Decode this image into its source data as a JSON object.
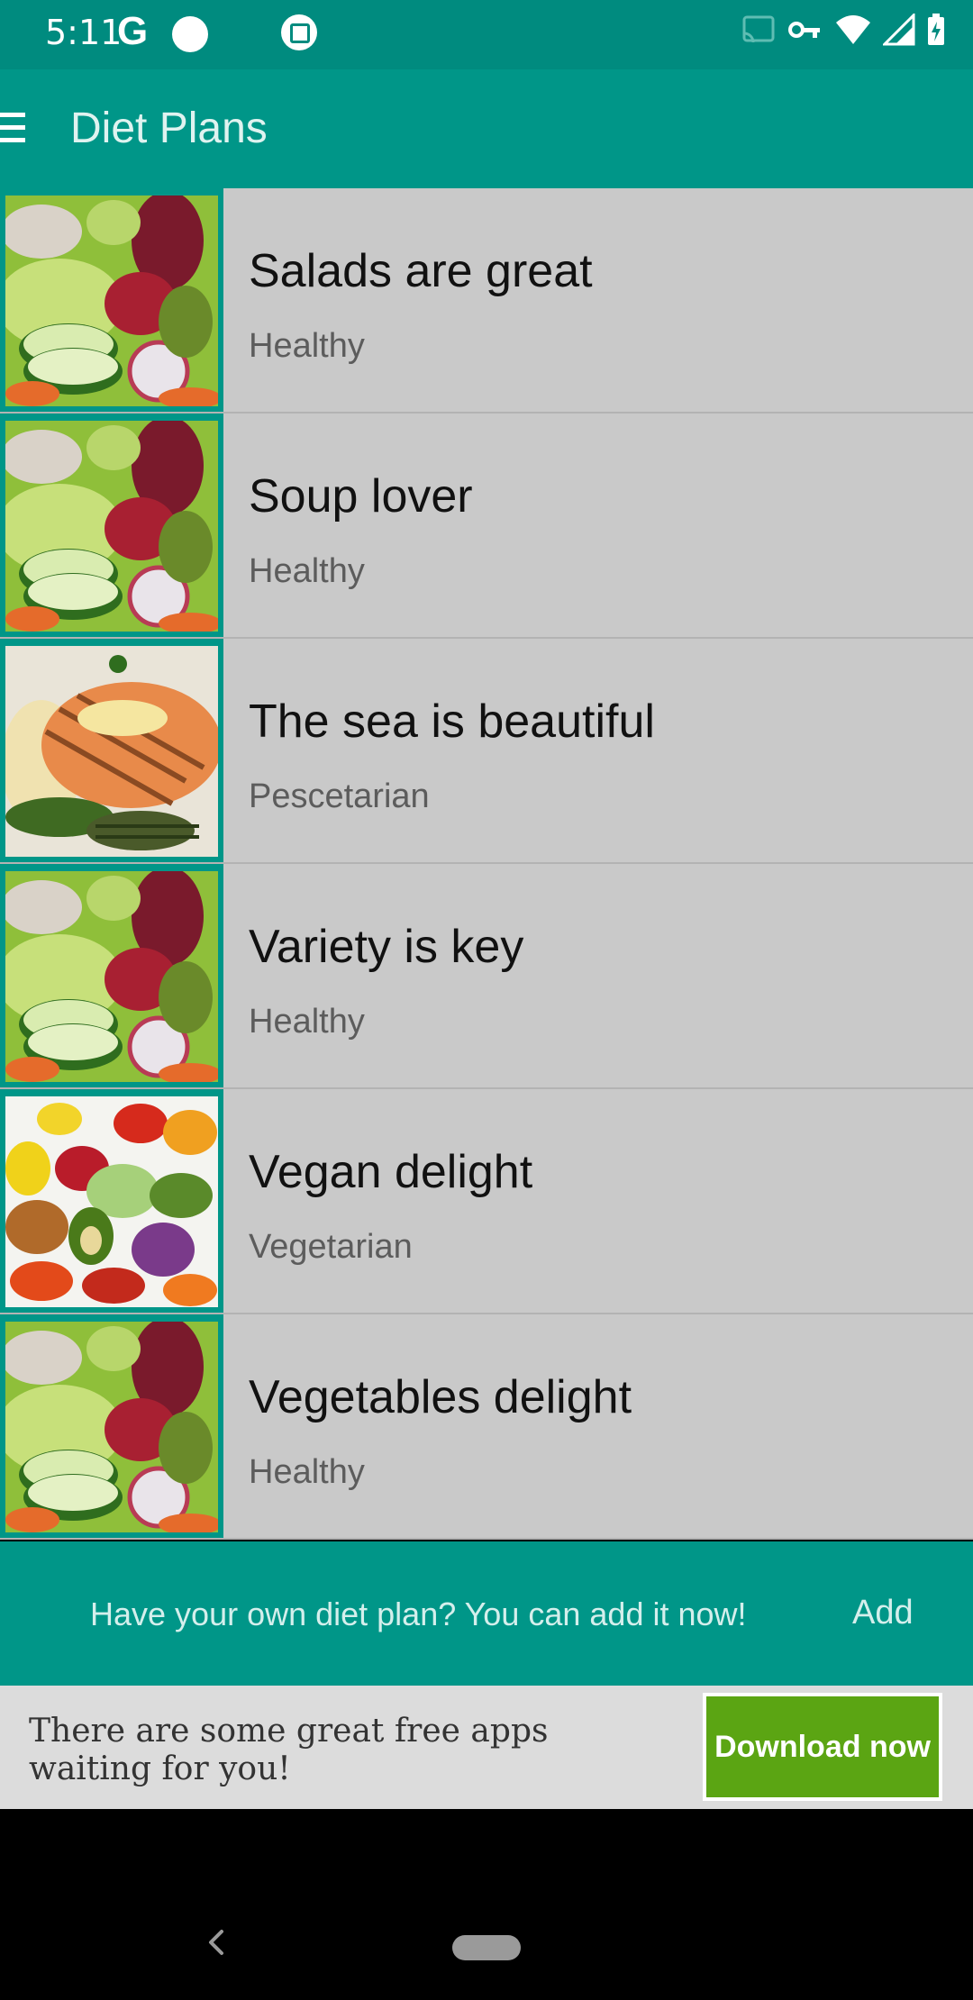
{
  "status_bar": {
    "time": "5:11",
    "carrier_glyph": "G",
    "icons": [
      "notification-dot-icon",
      "screenshot-icon",
      "cast-icon",
      "vpn-key-icon",
      "wifi-icon",
      "signal-icon",
      "battery-charging-icon"
    ]
  },
  "app_bar": {
    "title": "Diet Plans",
    "menu_icon": "menu-icon"
  },
  "diet_plans": [
    {
      "title": "Salads are great",
      "category": "Healthy",
      "image": "salad"
    },
    {
      "title": "Soup lover",
      "category": "Healthy",
      "image": "salad"
    },
    {
      "title": "The sea is beautiful",
      "category": "Pescetarian",
      "image": "salmon"
    },
    {
      "title": "Variety is key",
      "category": "Healthy",
      "image": "salad"
    },
    {
      "title": "Vegan delight",
      "category": "Vegetarian",
      "image": "vegetables"
    },
    {
      "title": "Vegetables delight",
      "category": "Healthy",
      "image": "salad"
    }
  ],
  "add_prompt": {
    "text": "Have your own diet plan? You can add it now!",
    "button_label": "Add"
  },
  "ad": {
    "text": "There are some great free apps waiting for you!",
    "button_label": "Download now"
  },
  "colors": {
    "primary": "#009688",
    "status_bar": "#008b7f",
    "list_background": "#c9c9c9",
    "ad_button": "#5ba513"
  }
}
